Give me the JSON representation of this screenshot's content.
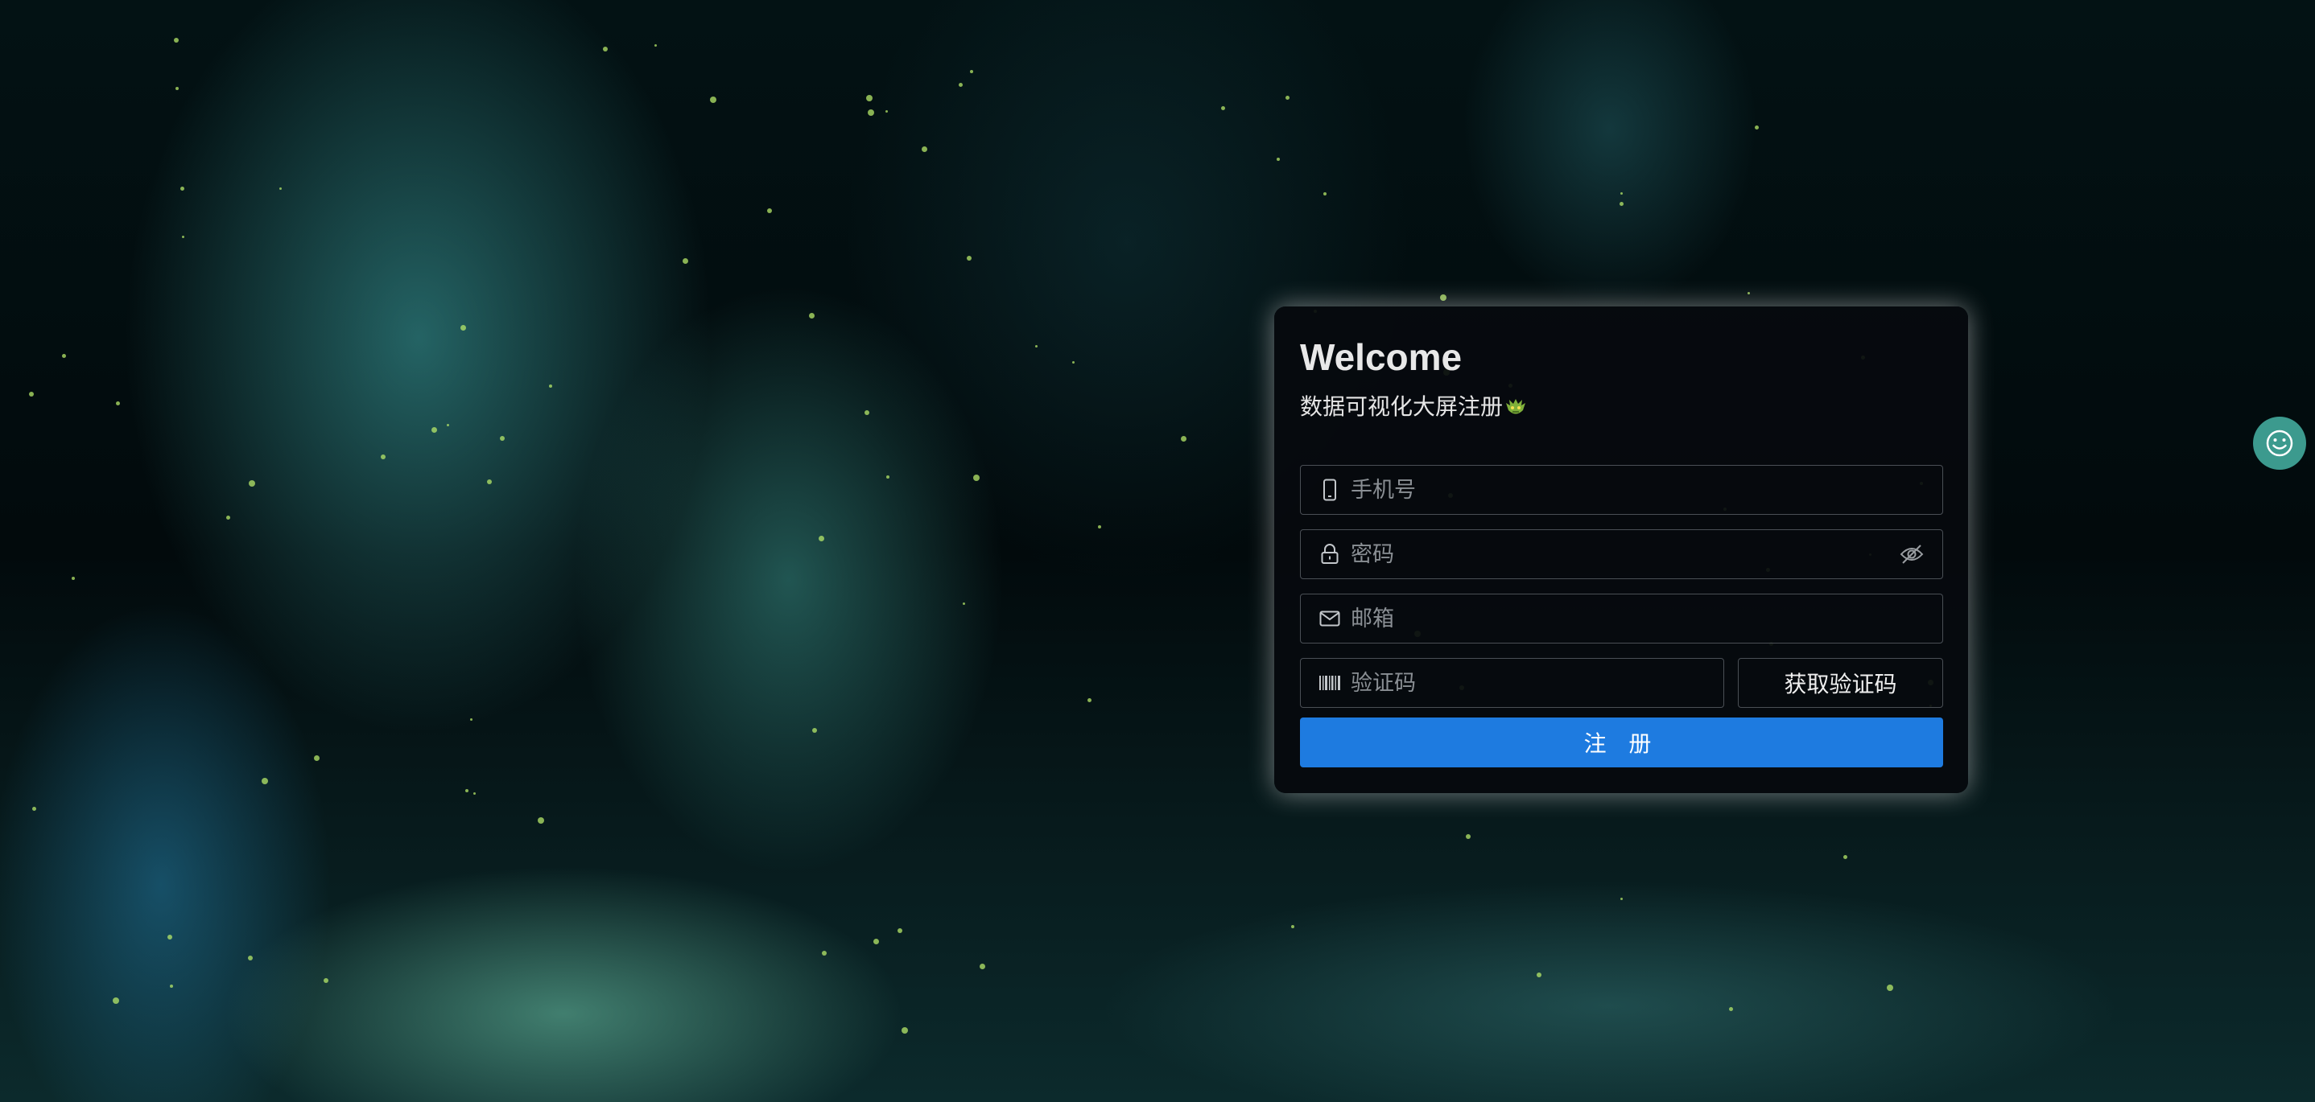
{
  "login_card": {
    "title": "Welcome",
    "subtitle": "数据可视化大屏注册",
    "subtitle_icon": "goblin-emoji-icon",
    "phone_placeholder": "手机号",
    "phone_icon": "mobile-phone-icon",
    "password_placeholder": "密码",
    "password_icon": "lock-icon",
    "password_toggle_icon": "eye-hidden-icon",
    "email_placeholder": "邮箱",
    "email_icon": "mail-icon",
    "code_placeholder": "验证码",
    "code_icon": "barcode-icon",
    "get_code_label": "获取验证码",
    "register_label": "注 册"
  },
  "float_button": {
    "icon": "smiley-icon"
  },
  "colors": {
    "primary_button": "#1e7be0",
    "float_button": "#3c9a8e",
    "card_background": "#060a0e"
  }
}
